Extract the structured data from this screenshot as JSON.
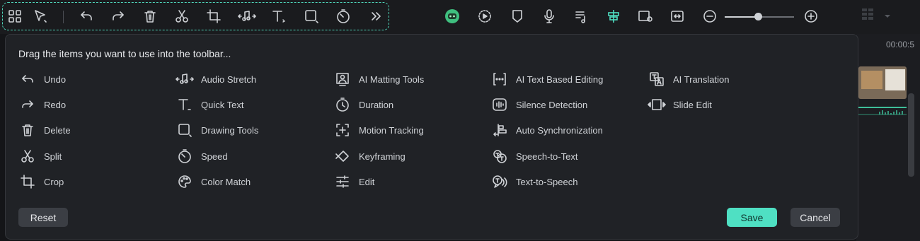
{
  "toolbar": {
    "customizable_icons": [
      "grid-icon",
      "select-arrow-icon",
      "undo-icon",
      "redo-icon",
      "delete-icon",
      "split-icon",
      "crop-icon",
      "audio-stretch-icon",
      "text-icon",
      "shape-icon",
      "speed-icon",
      "more-icon"
    ],
    "right_icons": [
      "ai-avatar-icon",
      "render-preview-icon",
      "marker-icon",
      "microphone-icon",
      "audio-list-icon",
      "snap-icon",
      "preview-toggle-icon",
      "fit-icon",
      "zoom-out-icon",
      "zoom-in-icon",
      "layout-grid-icon",
      "dropdown-arrow-icon"
    ],
    "zoom_level": 0.48
  },
  "timeline": {
    "time_code": "00:00:5"
  },
  "dialog": {
    "title": "Drag the items you want to use into the toolbar...",
    "columns": [
      [
        {
          "label": "Undo",
          "icon": "undo-icon"
        },
        {
          "label": "Redo",
          "icon": "redo-icon"
        },
        {
          "label": "Delete",
          "icon": "delete-icon"
        },
        {
          "label": "Split",
          "icon": "split-icon"
        },
        {
          "label": "Crop",
          "icon": "crop-icon"
        }
      ],
      [
        {
          "label": "Audio Stretch",
          "icon": "audio-stretch-icon"
        },
        {
          "label": "Quick Text",
          "icon": "quick-text-icon"
        },
        {
          "label": "Drawing Tools",
          "icon": "drawing-tools-icon"
        },
        {
          "label": "Speed",
          "icon": "speed-icon"
        },
        {
          "label": "Color Match",
          "icon": "color-match-icon"
        }
      ],
      [
        {
          "label": "AI Matting Tools",
          "icon": "ai-matting-icon"
        },
        {
          "label": "Duration",
          "icon": "duration-icon"
        },
        {
          "label": "Motion Tracking",
          "icon": "motion-tracking-icon"
        },
        {
          "label": "Keyframing",
          "icon": "keyframing-icon"
        },
        {
          "label": "Edit",
          "icon": "edit-sliders-icon"
        }
      ],
      [
        {
          "label": "AI Text Based Editing",
          "icon": "ai-text-editing-icon"
        },
        {
          "label": "Silence Detection",
          "icon": "silence-detection-icon"
        },
        {
          "label": "Auto Synchronization",
          "icon": "auto-sync-icon"
        },
        {
          "label": "Speech-to-Text",
          "icon": "speech-to-text-icon"
        },
        {
          "label": "Text-to-Speech",
          "icon": "text-to-speech-icon"
        }
      ],
      [
        {
          "label": "AI Translation",
          "icon": "ai-translation-icon"
        },
        {
          "label": "Slide Edit",
          "icon": "slide-edit-icon"
        }
      ]
    ],
    "reset_label": "Reset",
    "save_label": "Save",
    "cancel_label": "Cancel"
  },
  "colors": {
    "accent": "#4fe0c3",
    "dialog_bg": "#202226",
    "app_bg": "#141518"
  }
}
